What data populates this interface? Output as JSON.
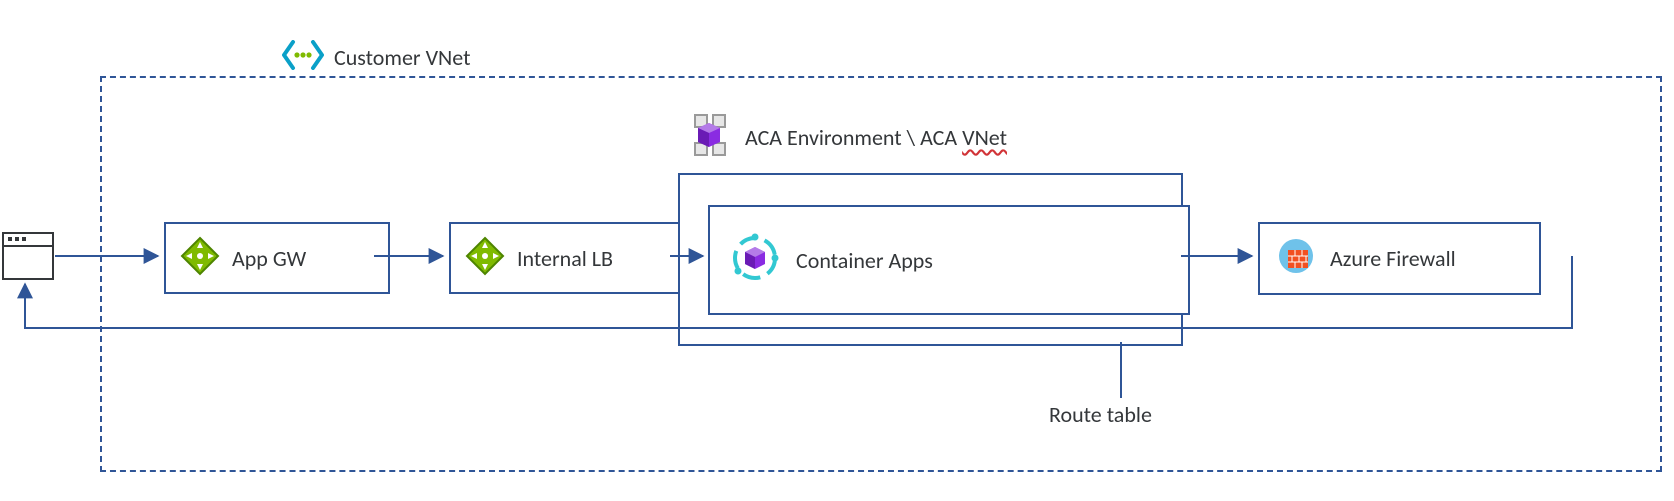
{
  "vnet_title": "Customer VNet",
  "aca_env_label_prefix": "ACA Environment \\ ACA ",
  "aca_env_label_word": "VNet",
  "app_gw_label": "App GW",
  "internal_lb_label": "Internal LB",
  "container_apps_label": "Container Apps",
  "firewall_label": "Azure Firewall",
  "route_table_label": "Route table",
  "colors": {
    "border": "#2f5597",
    "arrow": "#2f5597",
    "text": "#34373a",
    "accent_green": "#7fba00",
    "accent_cyan": "#32c8d2",
    "accent_purple": "#8a2be2",
    "accent_red": "#f25022"
  },
  "icons": {
    "browser": "browser-icon",
    "vnet": "vnet-icon",
    "app_gw": "app-gw-icon",
    "internal_lb": "load-balancer-icon",
    "aca_env": "container-env-icon",
    "container_apps": "container-apps-icon",
    "firewall": "firewall-icon"
  }
}
